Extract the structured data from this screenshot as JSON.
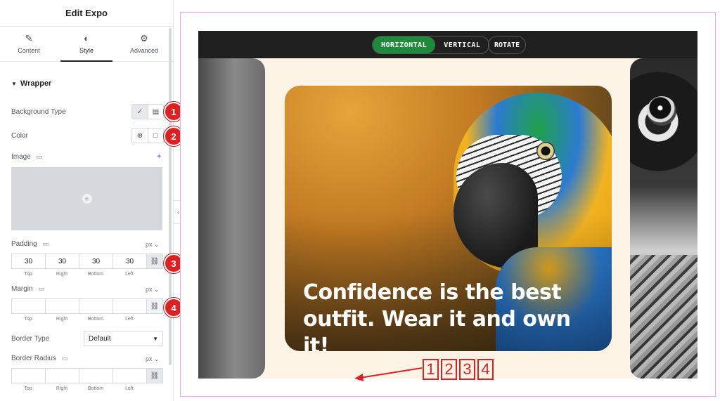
{
  "panel": {
    "title": "Edit Expo",
    "tabs": [
      {
        "label": "Content",
        "icon": "pencil-icon"
      },
      {
        "label": "Style",
        "icon": "half-circle-icon"
      },
      {
        "label": "Advanced",
        "icon": "gear-icon"
      }
    ],
    "section": "Wrapper",
    "background_type_label": "Background Type",
    "color_label": "Color",
    "image_label": "Image",
    "padding": {
      "label": "Padding",
      "unit": "px",
      "values": [
        "30",
        "30",
        "30",
        "30"
      ],
      "captions": [
        "Top",
        "Right",
        "Bottom",
        "Left"
      ]
    },
    "margin": {
      "label": "Margin",
      "unit": "px",
      "values": [
        "",
        "",
        "",
        ""
      ],
      "captions": [
        "Top",
        "Right",
        "Bottom",
        "Left"
      ]
    },
    "border_type": {
      "label": "Border Type",
      "value": "Default"
    },
    "border_radius": {
      "label": "Border Radius",
      "unit": "px",
      "values": [
        "",
        "",
        "",
        ""
      ],
      "captions": [
        "Top",
        "Right",
        "Bottom",
        "Left"
      ]
    }
  },
  "badges": [
    "1",
    "2",
    "3",
    "4"
  ],
  "preview": {
    "buttons": {
      "horizontal": "HORIZONTAL",
      "vertical": "VERTICAL",
      "rotate": "ROTATE"
    },
    "quote": "Confidence is the best outfit. Wear it and own it!",
    "annotation_numbers": [
      "1",
      "2",
      "3",
      "4"
    ]
  },
  "colors": {
    "active_orientation": "#1f8a3c",
    "badge": "#e02020",
    "frame_border": "#f0a6e8",
    "stage_background": "#fdf4e6"
  }
}
